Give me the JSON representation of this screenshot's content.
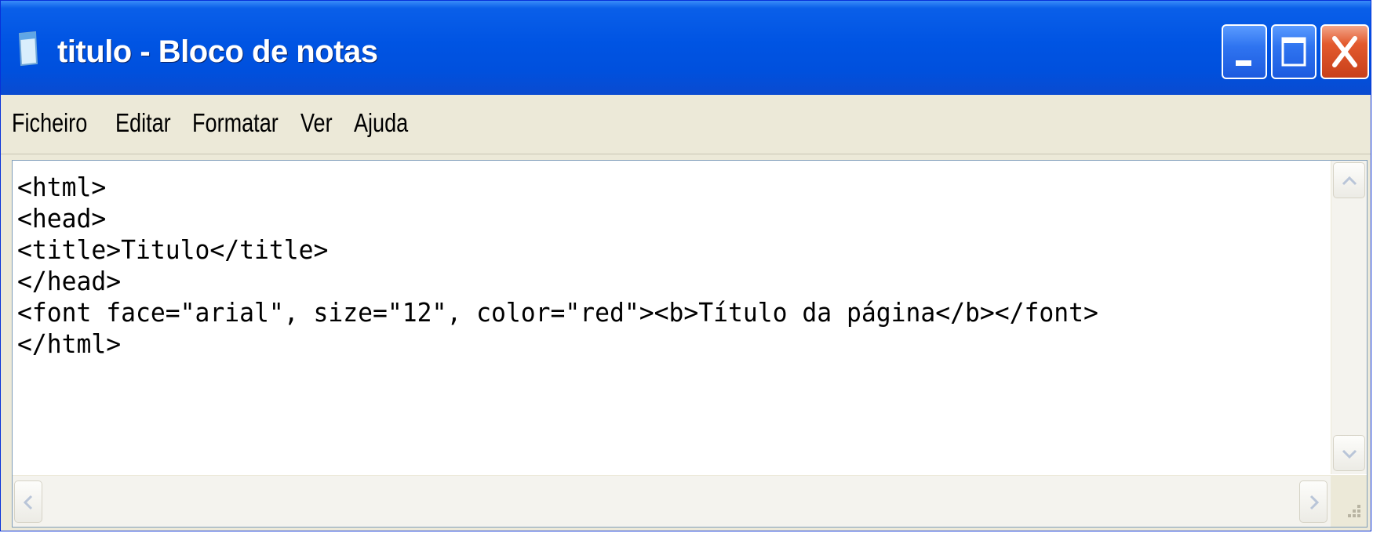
{
  "window": {
    "title": "titulo - Bloco de notas",
    "icon": "notepad-icon",
    "titlebar_color": "#0054e3",
    "close_button_color": "#e35a2e"
  },
  "caption_buttons": {
    "minimize": "minimize-icon",
    "maximize": "maximize-icon",
    "close": "close-icon"
  },
  "menu": {
    "items": [
      {
        "label": "Ficheiro"
      },
      {
        "label": "Editar"
      },
      {
        "label": "Formatar"
      },
      {
        "label": "Ver"
      },
      {
        "label": "Ajuda"
      }
    ]
  },
  "editor": {
    "lines": [
      "<html>",
      "<head>",
      "<title>Titulo</title>",
      "</head>",
      "<font face=\"arial\", size=\"12\", color=\"red\"><b>Título da página</b></font>",
      "</html>"
    ]
  },
  "scrollbars": {
    "up": "scroll-up-arrow-icon",
    "down": "scroll-down-arrow-icon",
    "left": "scroll-left-arrow-icon",
    "right": "scroll-right-arrow-icon",
    "grip": "size-grip-icon"
  }
}
